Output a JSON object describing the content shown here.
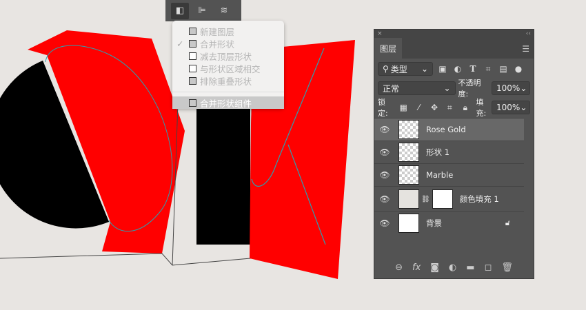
{
  "toolbar": {
    "icons": [
      "path-operations-icon",
      "align-icon",
      "arrange-icon"
    ]
  },
  "path_menu": {
    "items": [
      {
        "label": "新建图层",
        "icon": "new-layer-icon",
        "checked": false
      },
      {
        "label": "合并形状",
        "icon": "combine-shapes-icon",
        "checked": true
      },
      {
        "label": "减去顶层形状",
        "icon": "subtract-front-icon",
        "checked": false
      },
      {
        "label": "与形状区域相交",
        "icon": "intersect-icon",
        "checked": false
      },
      {
        "label": "排除重叠形状",
        "icon": "exclude-icon",
        "checked": false
      }
    ],
    "merge_label": "合并形状组件",
    "check": "✓"
  },
  "layers_panel": {
    "close": "×",
    "collapse": "‹‹",
    "tab": "图层",
    "filter": "类型",
    "blend_mode": "正常",
    "opacity_label": "不透明度:",
    "opacity": "100%",
    "lock_label": "锁定:",
    "fill_label": "填充:",
    "fill": "100%",
    "layers": [
      {
        "name": "Rose Gold",
        "active": true
      },
      {
        "name": "形状 1",
        "active": false
      },
      {
        "name": "Marble",
        "active": false
      },
      {
        "name": "颜色填充 1",
        "active": false
      },
      {
        "name": "背景",
        "active": false,
        "locked": true
      }
    ]
  },
  "colors": {
    "canvas": "#e8e5e2",
    "shape_red": "#ff0000",
    "shape_black": "#000000",
    "path": "#2aa0b0"
  }
}
